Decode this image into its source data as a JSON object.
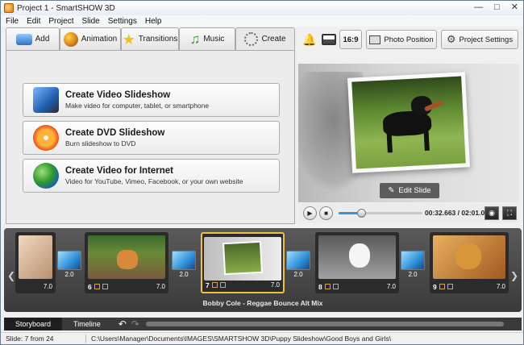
{
  "window": {
    "title": "Project 1 - SmartSHOW 3D"
  },
  "menu": [
    "File",
    "Edit",
    "Project",
    "Slide",
    "Settings",
    "Help"
  ],
  "tabs": [
    {
      "label": "Add",
      "icon": "add-media-icon"
    },
    {
      "label": "Animation",
      "icon": "palette-icon"
    },
    {
      "label": "Transitions",
      "icon": "star-icon"
    },
    {
      "label": "Music",
      "icon": "music-note-icon"
    },
    {
      "label": "Create",
      "icon": "film-reel-icon",
      "active": true
    }
  ],
  "create_options": [
    {
      "title": "Create Video Slideshow",
      "desc": "Make video for computer, tablet, or smartphone",
      "icon": "video-device-icon"
    },
    {
      "title": "Create DVD Slideshow",
      "desc": "Burn slideshow to DVD",
      "icon": "dvd-disc-icon"
    },
    {
      "title": "Create Video for Internet",
      "desc": "Video for YouTube, Vimeo, Facebook, or your own website",
      "icon": "globe-icon"
    }
  ],
  "toolbar": {
    "aspect": "16:9",
    "photo_position": "Photo Position",
    "project_settings": "Project Settings"
  },
  "preview": {
    "edit_slide": "Edit Slide",
    "time": "00:32.663 / 02:01.000",
    "progress": 0.27
  },
  "storyboard": {
    "slides": [
      {
        "num": "",
        "duration": "7.0"
      },
      {
        "num": "6",
        "duration": "7.0"
      },
      {
        "num": "7",
        "duration": "7.0"
      },
      {
        "num": "8",
        "duration": "7.0"
      },
      {
        "num": "9",
        "duration": "7.0"
      }
    ],
    "transitions": [
      {
        "label": "2.0"
      },
      {
        "label": "2.0"
      },
      {
        "label": "2.0"
      },
      {
        "label": "2.0"
      }
    ],
    "music": "Bobby Cole - Reggae Bounce Alt Mix"
  },
  "bottom_tabs": {
    "storyboard": "Storyboard",
    "timeline": "Timeline"
  },
  "status": {
    "slide_info": "Slide: 7 from 24",
    "path": "C:\\Users\\Manager\\Documents\\IMAGES\\SMARTSHOW 3D\\Puppy Slideshow\\Good Boys and Girls\\"
  }
}
